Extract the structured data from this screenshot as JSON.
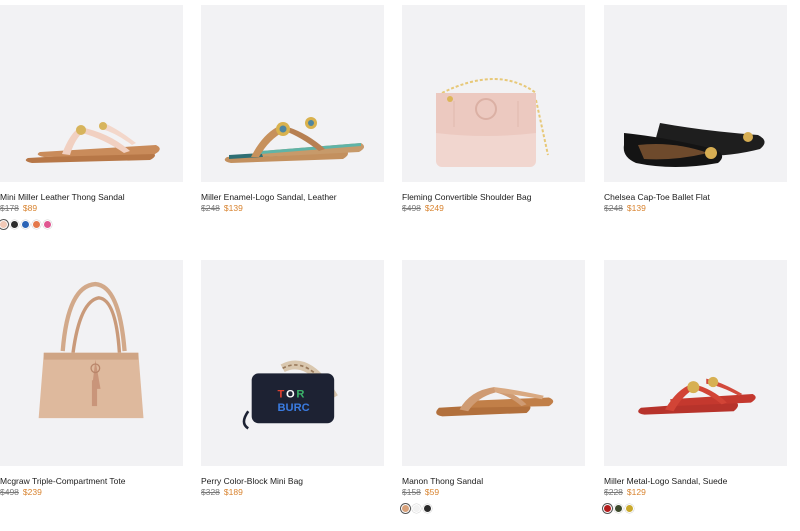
{
  "products": [
    {
      "name": "Mini Miller Leather Thong Sandal",
      "original_price": "$178",
      "sale_price": "$89",
      "swatches": [
        "#f0c9b7",
        "#2b2b2b",
        "#2a63b5",
        "#e4784a",
        "#e05590"
      ],
      "selected_swatch": 0
    },
    {
      "name": "Miller Enamel-Logo Sandal, Leather",
      "original_price": "$248",
      "sale_price": "$139",
      "swatches": [],
      "selected_swatch": -1
    },
    {
      "name": "Fleming Convertible Shoulder Bag",
      "original_price": "$498",
      "sale_price": "$249",
      "swatches": [],
      "selected_swatch": -1
    },
    {
      "name": "Chelsea Cap-Toe Ballet Flat",
      "original_price": "$248",
      "sale_price": "$139",
      "swatches": [],
      "selected_swatch": -1
    },
    {
      "name": "Mcgraw Triple-Compartment Tote",
      "original_price": "$498",
      "sale_price": "$239",
      "swatches": [],
      "selected_swatch": -1
    },
    {
      "name": "Perry Color-Block Mini Bag",
      "original_price": "$328",
      "sale_price": "$189",
      "swatches": [],
      "selected_swatch": -1
    },
    {
      "name": "Manon Thong Sandal",
      "original_price": "$158",
      "sale_price": "$59",
      "swatches": [
        "#d8a17a",
        "#f2f2f2",
        "#2b2b2b"
      ],
      "selected_swatch": 0
    },
    {
      "name": "Miller Metal-Logo Sandal, Suede",
      "original_price": "$228",
      "sale_price": "$129",
      "swatches": [
        "#b21d1d",
        "#3d4a2c",
        "#c9a92c"
      ],
      "selected_swatch": 0
    }
  ],
  "colors": {
    "sale_price": "#d8832f",
    "image_bg": "#f2f2f4"
  }
}
